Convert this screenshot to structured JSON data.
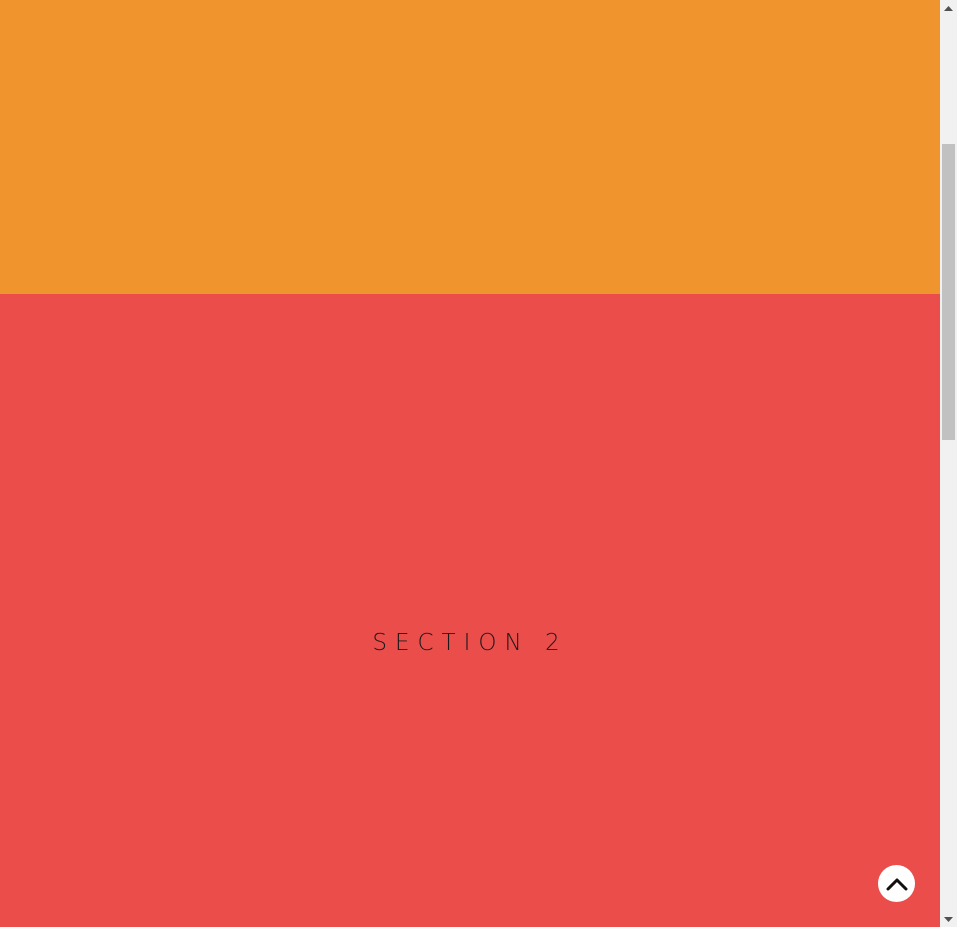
{
  "colors": {
    "section_1_background": "#F0952D",
    "section_2_background": "#EB4D4B",
    "scroll_top_button_background": "#FFFFFF",
    "scroll_top_icon": "#111111"
  },
  "sections": [
    {
      "id": "section-1",
      "title": ""
    },
    {
      "id": "section-2",
      "title": "SECTION 2"
    }
  ],
  "scroll_top_button": {
    "icon": "chevron-up-icon"
  },
  "scrollbar": {
    "up_icon": "scroll-up-arrow-icon",
    "down_icon": "scroll-down-arrow-icon",
    "position_fraction": 0.16
  }
}
